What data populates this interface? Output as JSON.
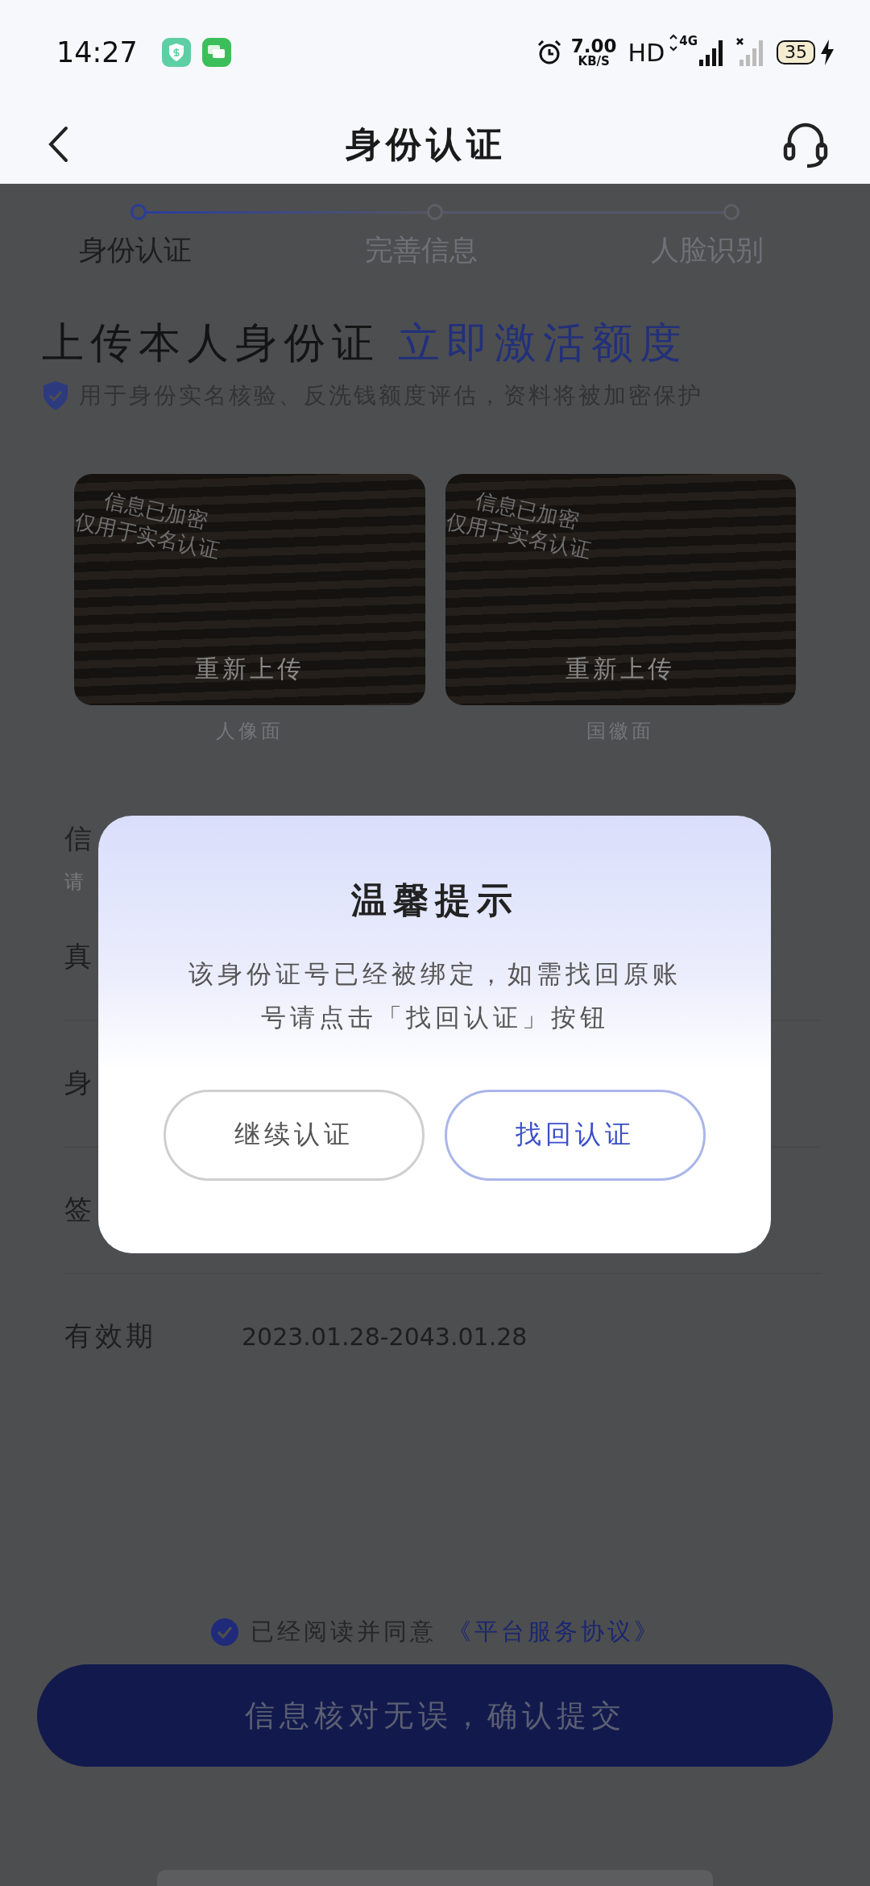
{
  "status_bar": {
    "time": "14:27",
    "net_speed": "7.00",
    "net_unit": "KB/S",
    "hd": "HD",
    "network": "4G",
    "battery": "35"
  },
  "header": {
    "title": "身份认证"
  },
  "steps": [
    {
      "label": "身份认证",
      "selected": true
    },
    {
      "label": "完善信息",
      "selected": false
    },
    {
      "label": "人脸识别",
      "selected": false
    }
  ],
  "headline": {
    "main": "上传本人身份证",
    "highlight": "立即激活额度"
  },
  "notice": "用于身份实名核验、反洗钱额度评估，资料将被加密保护",
  "uploads": [
    {
      "stamp_line_1": "信息已加密",
      "stamp_line_2": "仅用于实名认证",
      "action": "重新上传",
      "caption": "人像面"
    },
    {
      "stamp_line_1": "信息已加密",
      "stamp_line_2": "仅用于实名认证",
      "action": "重新上传",
      "caption": "国徽面"
    }
  ],
  "form": {
    "section_title": "信",
    "section_hint": "请",
    "rows": [
      {
        "label": "真"
      },
      {
        "label": "身"
      },
      {
        "label": "签"
      },
      {
        "label": "有效期",
        "value": "2023.01.28-2043.01.28"
      }
    ]
  },
  "agreement": {
    "checked": true,
    "text": "已经阅读并同意",
    "link": "《平台服务协议》"
  },
  "submit": "信息核对无误，确认提交",
  "dialog": {
    "title": "温馨提示",
    "message": "该身份证号已经被绑定，如需找回原账号请点击「找回认证」按钮",
    "buttons": [
      {
        "label": "继续认证",
        "kind": "secondary"
      },
      {
        "label": "找回认证",
        "kind": "primary"
      }
    ]
  }
}
